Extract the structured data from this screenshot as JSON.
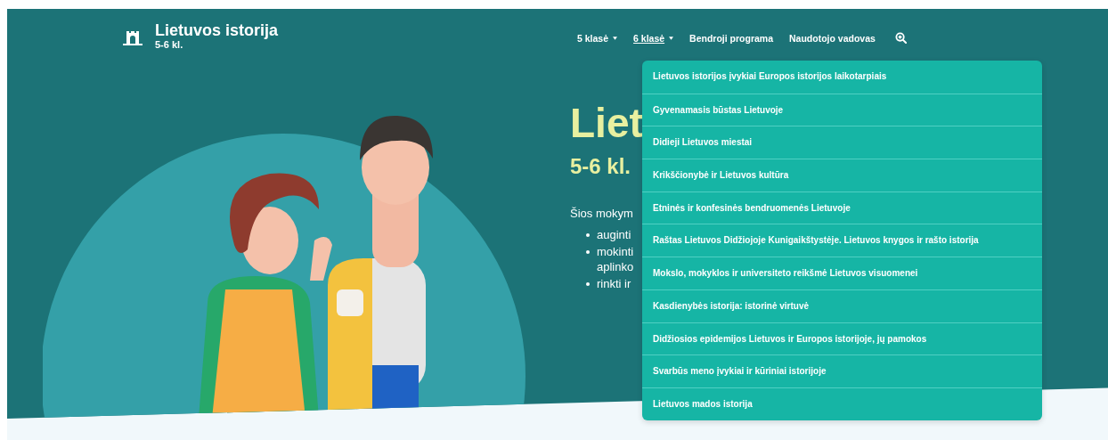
{
  "header": {
    "title": "Lietuvos istorija",
    "subtitle": "5-6 kl."
  },
  "nav": [
    {
      "label": "5 klasė",
      "caret": true,
      "selected": false
    },
    {
      "label": "6 klasė",
      "caret": true,
      "selected": true
    },
    {
      "label": "Bendroji programa",
      "caret": false,
      "selected": false
    },
    {
      "label": "Naudotojo vadovas",
      "caret": false,
      "selected": false
    }
  ],
  "hero": {
    "title": "Liet",
    "subtitle": "5-6 kl.",
    "intro": "Šios mokym",
    "bullets": [
      {
        "lines": [
          "auginti"
        ]
      },
      {
        "lines": [
          "mokinti",
          "aplinko"
        ]
      },
      {
        "lines": [
          "rinkti ir"
        ]
      }
    ]
  },
  "dropdown": {
    "items": [
      {
        "label": "Lietuvos istorijos įvykiai Europos istorijos laikotarpiais"
      },
      {
        "label": "Gyvenamasis būstas Lietuvoje"
      },
      {
        "label": "Didieji Lietuvos miestai"
      },
      {
        "label": "Krikščionybė ir Lietuvos kultūra"
      },
      {
        "label": "Etninės ir konfesinės bendruomenės Lietuvoje"
      },
      {
        "label": "Raštas Lietuvos Didžiojoje Kunigaikštystėje. Lietuvos knygos ir rašto istorija"
      },
      {
        "label": "Mokslo, mokyklos ir universiteto reikšmė Lietuvos visuomenei"
      },
      {
        "label": "Kasdienybės istorija: istorinė virtuvė"
      },
      {
        "label": "Didžiosios epidemijos Lietuvos ir Europos istorijoje, jų pamokos"
      },
      {
        "label": "Svarbūs meno įvykiai ir kūriniai istorijoje"
      },
      {
        "label": "Lietuvos mados istorija"
      }
    ]
  }
}
